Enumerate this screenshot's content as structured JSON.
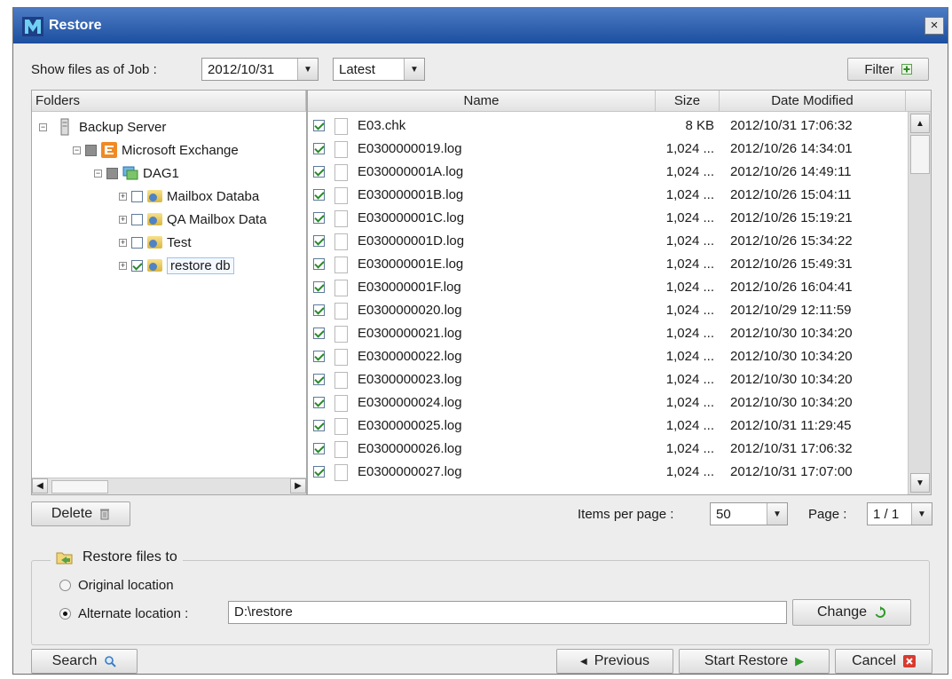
{
  "window": {
    "title": "Restore",
    "close_glyph": "×"
  },
  "toolbar": {
    "show_files_label": "Show files as of Job :",
    "job_date": "2012/10/31",
    "version": "Latest",
    "filter_label": "Filter"
  },
  "folders": {
    "header": "Folders",
    "tree": [
      {
        "label": "Backup Server",
        "expander": "−",
        "check": "none",
        "icon": "server-icon"
      },
      {
        "label": "Microsoft Exchange",
        "expander": "−",
        "check": "partial",
        "icon": "exchange-icon"
      },
      {
        "label": "DAG1",
        "expander": "−",
        "check": "partial",
        "icon": "dag-icon"
      },
      {
        "label": "Mailbox Databa",
        "expander": "+",
        "check": "unchecked",
        "icon": "database-folder-icon"
      },
      {
        "label": "QA Mailbox Data",
        "expander": "+",
        "check": "unchecked",
        "icon": "database-folder-icon"
      },
      {
        "label": "Test",
        "expander": "+",
        "check": "unchecked",
        "icon": "database-folder-icon"
      },
      {
        "label": "restore db",
        "expander": "+",
        "check": "checked",
        "icon": "database-folder-icon"
      }
    ]
  },
  "files": {
    "columns": {
      "name": "Name",
      "size": "Size",
      "date": "Date Modified"
    },
    "rows": [
      {
        "name": "E03.chk",
        "size": "8 KB",
        "date": "2012/10/31 17:06:32"
      },
      {
        "name": "E0300000019.log",
        "size": "1,024 ...",
        "date": "2012/10/26 14:34:01"
      },
      {
        "name": "E030000001A.log",
        "size": "1,024 ...",
        "date": "2012/10/26 14:49:11"
      },
      {
        "name": "E030000001B.log",
        "size": "1,024 ...",
        "date": "2012/10/26 15:04:11"
      },
      {
        "name": "E030000001C.log",
        "size": "1,024 ...",
        "date": "2012/10/26 15:19:21"
      },
      {
        "name": "E030000001D.log",
        "size": "1,024 ...",
        "date": "2012/10/26 15:34:22"
      },
      {
        "name": "E030000001E.log",
        "size": "1,024 ...",
        "date": "2012/10/26 15:49:31"
      },
      {
        "name": "E030000001F.log",
        "size": "1,024 ...",
        "date": "2012/10/26 16:04:41"
      },
      {
        "name": "E0300000020.log",
        "size": "1,024 ...",
        "date": "2012/10/29 12:11:59"
      },
      {
        "name": "E0300000021.log",
        "size": "1,024 ...",
        "date": "2012/10/30 10:34:20"
      },
      {
        "name": "E0300000022.log",
        "size": "1,024 ...",
        "date": "2012/10/30 10:34:20"
      },
      {
        "name": "E0300000023.log",
        "size": "1,024 ...",
        "date": "2012/10/30 10:34:20"
      },
      {
        "name": "E0300000024.log",
        "size": "1,024 ...",
        "date": "2012/10/30 10:34:20"
      },
      {
        "name": "E0300000025.log",
        "size": "1,024 ...",
        "date": "2012/10/31 11:29:45"
      },
      {
        "name": "E0300000026.log",
        "size": "1,024 ...",
        "date": "2012/10/31 17:06:32"
      },
      {
        "name": "E0300000027.log",
        "size": "1,024 ...",
        "date": "2012/10/31 17:07:00"
      }
    ]
  },
  "pagination": {
    "delete_label": "Delete",
    "items_per_page_label": "Items per page :",
    "items_per_page": "50",
    "page_label": "Page :",
    "page_value": "1 / 1"
  },
  "restore": {
    "group_label": "Restore files to",
    "original_label": "Original location",
    "alternate_label": "Alternate location :",
    "alternate_path": "D:\\restore",
    "change_label": "Change"
  },
  "footer": {
    "search_label": "Search",
    "previous_label": "Previous",
    "start_restore_label": "Start Restore",
    "cancel_label": "Cancel"
  },
  "colors": {
    "title_bar": "#1c4fa0",
    "check_green": "#2a8a2a",
    "cancel_red": "#d93a2f"
  }
}
